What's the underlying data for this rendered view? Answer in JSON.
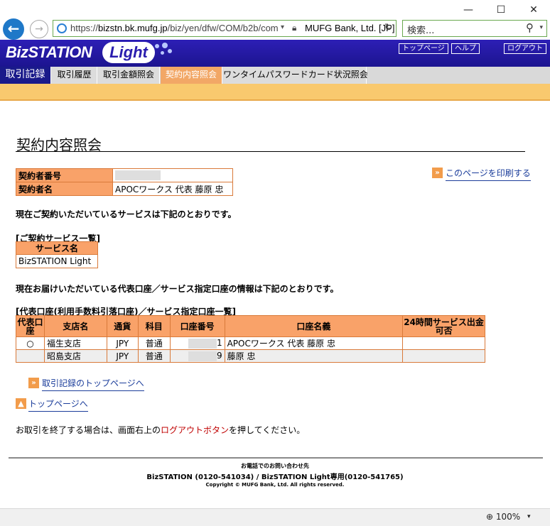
{
  "window": {
    "minimize": "—",
    "maximize": "☐",
    "close": "✕"
  },
  "browser": {
    "url_prefix": "https://",
    "url_host": "bizstn.bk.mufg.jp",
    "url_path": "/biz/yen/dfw/COM/b2b/com",
    "cert": "MUFG Bank, Ltd. [JP]",
    "search_placeholder": "検索...",
    "zoom": "100%"
  },
  "header": {
    "logo_main": "BizSTATION",
    "logo_sub": "Light",
    "links": [
      "トップページ",
      "ヘルプ",
      "ログアウト"
    ]
  },
  "tabs": [
    {
      "label": "取引記録"
    },
    {
      "label": "取引履歴"
    },
    {
      "label": "取引金額照会"
    },
    {
      "label": "契約内容照会"
    },
    {
      "label": "ワンタイムパスワードカード状況照会"
    }
  ],
  "page": {
    "title": "契約内容照会",
    "print_link": "このページを印刷する",
    "info": {
      "contractor_no_label": "契約者番号",
      "contractor_name_label": "契約者名",
      "contractor_name": "APOCワークス 代表 藤原 忠"
    },
    "note1": "現在ご契約いただいているサービスは下記のとおりです。",
    "services_heading": "[ご契約サービス一覧]",
    "services_col": "サービス名",
    "services": [
      "BizSTATION Light"
    ],
    "note2": "現在お届けいただいている代表口座／サービス指定口座の情報は下記のとおりです。",
    "accounts_heading": "[代表口座(利用手数料引落口座)／サービス指定口座一覧]",
    "accounts_cols": {
      "rep": "代表口座",
      "branch": "支店名",
      "currency": "通貨",
      "type": "科目",
      "number": "口座番号",
      "name": "口座名義",
      "service": "24時間サービス出金可否"
    },
    "accounts": [
      {
        "rep": "○",
        "branch": "福生支店",
        "currency": "JPY",
        "type": "普通",
        "number_tail": "1",
        "name": "APOCワークス 代表 藤原 忠",
        "service": ""
      },
      {
        "rep": "",
        "branch": "昭島支店",
        "currency": "JPY",
        "type": "普通",
        "number_tail": "9",
        "name": "藤原 忠",
        "service": ""
      }
    ],
    "trade_top_link": "取引記録のトップページへ",
    "top_link": "トップページへ",
    "end_note_pre": "お取引を終了する場合は、画面右上の",
    "end_note_red": "ログアウトボタン",
    "end_note_post": "を押してください。"
  },
  "footer": {
    "line1": "お電話でのお問い合わせ先",
    "line2": "BizSTATION (0120-541034) / BizSTATION Light専用(0120-541765)",
    "line3": "Copyright © MUFG Bank, Ltd. All rights reserved."
  }
}
